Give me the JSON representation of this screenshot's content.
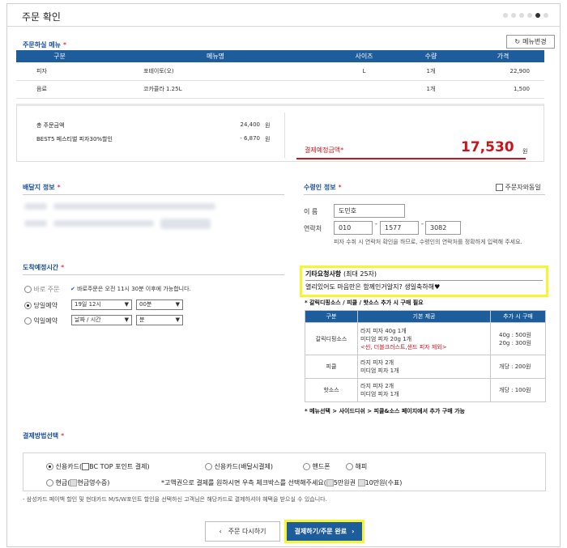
{
  "header": {
    "title": "주문 확인",
    "steps": [
      false,
      false,
      false,
      false,
      true,
      false
    ]
  },
  "menu_section": {
    "title": "주문하실 메뉴",
    "change_button": "메뉴변경",
    "columns": [
      "구분",
      "메뉴명",
      "사이즈",
      "수량",
      "가격"
    ],
    "rows": [
      [
        "피자",
        "포테이토(오)",
        "L",
        "1개",
        "22,900"
      ],
      [
        "음료",
        "코카콜라 1.25L",
        "",
        "1개",
        "1,500"
      ]
    ]
  },
  "summary": {
    "total_label": "총 주문금액",
    "total_value": "24,400",
    "won": "원",
    "discount_label": "BEST5 페스티벌 피자30%할인",
    "discount_value": "- 6,870",
    "pay_label": "결제예정금액",
    "pay_value": "17,530"
  },
  "delivery": {
    "title": "배달지 정보"
  },
  "receiver": {
    "title": "수령인 정보",
    "same_label": "주문자와동일",
    "name_label": "이  름",
    "name_value": "도민호",
    "phone_label": "연락처",
    "phone1": "010",
    "phone2": "1577",
    "phone3": "3082",
    "phone_note": "피자 수취 시 연락처 확인을 하므로, 수령인의 연락처를 정확하게 입력해 주세요."
  },
  "arrival": {
    "title": "도착예정시간",
    "now_label": "바로 주문",
    "now_note": "바로주문은 오전 11시 30분 이후에 가능합니다.",
    "today_label": "당일예약",
    "today_date": "19일 12시",
    "today_min": "00분",
    "next_label": "익일예약",
    "next_date": "날짜 / 시간",
    "next_min": "분"
  },
  "request": {
    "title": "기타요청사항",
    "limit": "(최대 25자)",
    "text": "열리있어도 마음만은 함께인거알지? 생일축하해♥",
    "sauce_note": "* 갈릭디핑소스 / 피클 / 핫소스 추가 시 구매 필요",
    "columns": [
      "구분",
      "기본 제공",
      "추가 시 구매"
    ],
    "rows": [
      {
        "name": "갈릭디핑소스",
        "lines": [
          "라지 피자 40g 1개",
          "미디엄 피자 20g 1개"
        ],
        "red": "<씬, 더블크러스트,샌드 피자 제외>",
        "price": [
          "40g : 500원",
          "20g : 300원"
        ]
      },
      {
        "name": "피클",
        "lines": [
          "라지 피자 2개",
          "미디엄 피자 1개"
        ],
        "red": "",
        "price": [
          "개당 : 200원"
        ]
      },
      {
        "name": "핫소스",
        "lines": [
          "라지 피자 2개",
          "미디엄 피자 1개"
        ],
        "red": "",
        "price": [
          "개당 : 100원"
        ]
      }
    ],
    "menu_note": "* 메뉴선택 > 사이드디쉬 > 피클&소스 페이지에서 추가 구매 가능"
  },
  "payment": {
    "title": "결제방법선택",
    "card_label": "신용카드(",
    "bc_label": "BC TOP 포인트 결제",
    "close_paren": ")",
    "card_delivery": "신용카드(배달시결제)",
    "phone": "핸드폰",
    "happy": "해피",
    "cash_label": "현금(",
    "cash_receipt": "현금영수증",
    "cash_note": "*고액권으로 결제를 원하시면 우측 체크박스를 선택해주세요(",
    "bill50k": "5만원권",
    "bill100k": "10만원(수표)",
    "footnote": "- 삼성카드 페이백 할인 및 현대카드 M/S/W포인트 할인을 선택하신 고객님은 해당카드로 결제하셔야 혜택을 받으실 수 있습니다."
  },
  "buttons": {
    "back": "주문 다시하기",
    "pay": "결제하기/주문 완료"
  },
  "colors": {
    "navy": "#1e5d9c",
    "red": "#c5161d",
    "highlight": "#f5f532"
  }
}
